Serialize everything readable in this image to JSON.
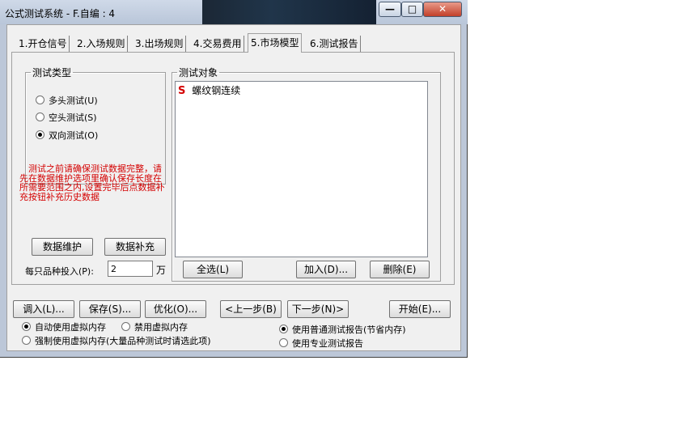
{
  "window": {
    "title": "公式测试系统 - F.自编 : 4",
    "minimize_glyph": "—",
    "maximize_glyph": "□",
    "close_glyph": "✕"
  },
  "tabs": [
    {
      "label": "1.开仓信号",
      "active": false
    },
    {
      "label": "2.入场规则",
      "active": false
    },
    {
      "label": "3.出场规则",
      "active": false
    },
    {
      "label": "4.交易费用",
      "active": false
    },
    {
      "label": "5.市场模型",
      "active": true
    },
    {
      "label": "6.测试报告",
      "active": false
    }
  ],
  "test_type": {
    "legend": "测试类型",
    "options": [
      {
        "label": "多头测试(U)",
        "checked": false
      },
      {
        "label": "空头测试(S)",
        "checked": false
      },
      {
        "label": "双向测试(O)",
        "checked": true
      }
    ]
  },
  "warning": "　测试之前请确保测试数据完整，请先在数据维护选项里确认保存长度在所需要范围之内,设置完毕后点数据补充按钮补充历史数据",
  "data_buttons": {
    "maintain": "数据维护",
    "supplement": "数据补充"
  },
  "investment": {
    "label": "每只品种投入(P):",
    "value": "2",
    "unit": "万"
  },
  "test_objects": {
    "legend": "测试对象",
    "items": [
      {
        "mark": "S",
        "name": "螺纹钢连续"
      }
    ],
    "select_all": "全选(L)",
    "add": "加入(D)...",
    "delete": "删除(E)"
  },
  "bottom_buttons": {
    "load": "调入(L)...",
    "save": "保存(S)...",
    "optimize": "优化(O)...",
    "prev": "<上一步(B)",
    "next": "下一步(N)>",
    "start": "开始(E)..."
  },
  "memory_options": [
    {
      "label": "自动使用虚拟内存",
      "checked": true
    },
    {
      "label": "禁用虚拟内存",
      "checked": false
    },
    {
      "label": "强制使用虚拟内存(大量品种测试时请选此项)",
      "checked": false
    }
  ],
  "report_options": [
    {
      "label": "使用普通测试报告(节省内存)",
      "checked": true
    },
    {
      "label": "使用专业测试报告",
      "checked": false
    }
  ]
}
